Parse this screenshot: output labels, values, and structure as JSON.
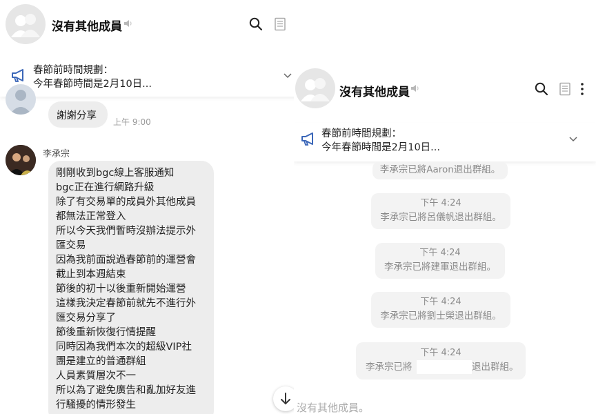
{
  "left": {
    "title": "沒有其他成員",
    "announcement": {
      "title": "春節前時間規劃：",
      "body": "今年春節時間是2月10日..."
    },
    "messages": [
      {
        "text": "謝謝分享",
        "time": "上午 9:00"
      },
      {
        "sender": "李承宗",
        "lines": [
          "剛剛收到bgc線上客服通知",
          "bgc正在進行網路升級",
          "除了有交易單的成員外其他成員",
          "都無法正常登入",
          "所以今天我們暫時沒辦法提示外",
          "匯交易",
          "因為我前面說過春節前的運營會",
          "截止到本週結束",
          "節後的初十以後重新開始運營",
          "這樣我決定春節前就先不進行外",
          "匯交易分享了",
          "節後重新恢復行情提醒",
          "同時因為我們本次的超級VIP社",
          "團是建立的普通群組",
          "人員素質層次不一",
          "所以為了避免廣告和亂加好友進",
          "行騷擾的情形發生"
        ]
      }
    ]
  },
  "right": {
    "title": "沒有其他成員",
    "announcement": {
      "title": "春節前時間規劃：",
      "body": "今年春節時間是2月10日..."
    },
    "system_messages": [
      {
        "time": "",
        "text": "李承宗已將Aaron退出群組。"
      },
      {
        "time": "下午 4:24",
        "text": "李承宗已將呂儀帆退出群組。"
      },
      {
        "time": "下午 4:24",
        "text": "李承宗已將建軍退出群組。"
      },
      {
        "time": "下午 4:24",
        "text": "李承宗已將劉士榮退出群組。"
      },
      {
        "time": "下午 4:24",
        "text_start": "李承宗已將",
        "text_end": "退出群組。"
      }
    ],
    "input_placeholder": "沒有其他成員。"
  },
  "icons": {
    "avatar": "group-avatar-icon",
    "mute": "speaker-muted-icon",
    "search": "search-icon",
    "notes": "notes-icon",
    "more": "more-vertical-icon",
    "announce": "megaphone-icon",
    "expand": "chevron-down-icon",
    "scroll": "arrow-down-icon"
  },
  "colors": {
    "accent": "#3a66b8",
    "bubble": "#ededed",
    "system_bubble": "#f3f3f3"
  }
}
